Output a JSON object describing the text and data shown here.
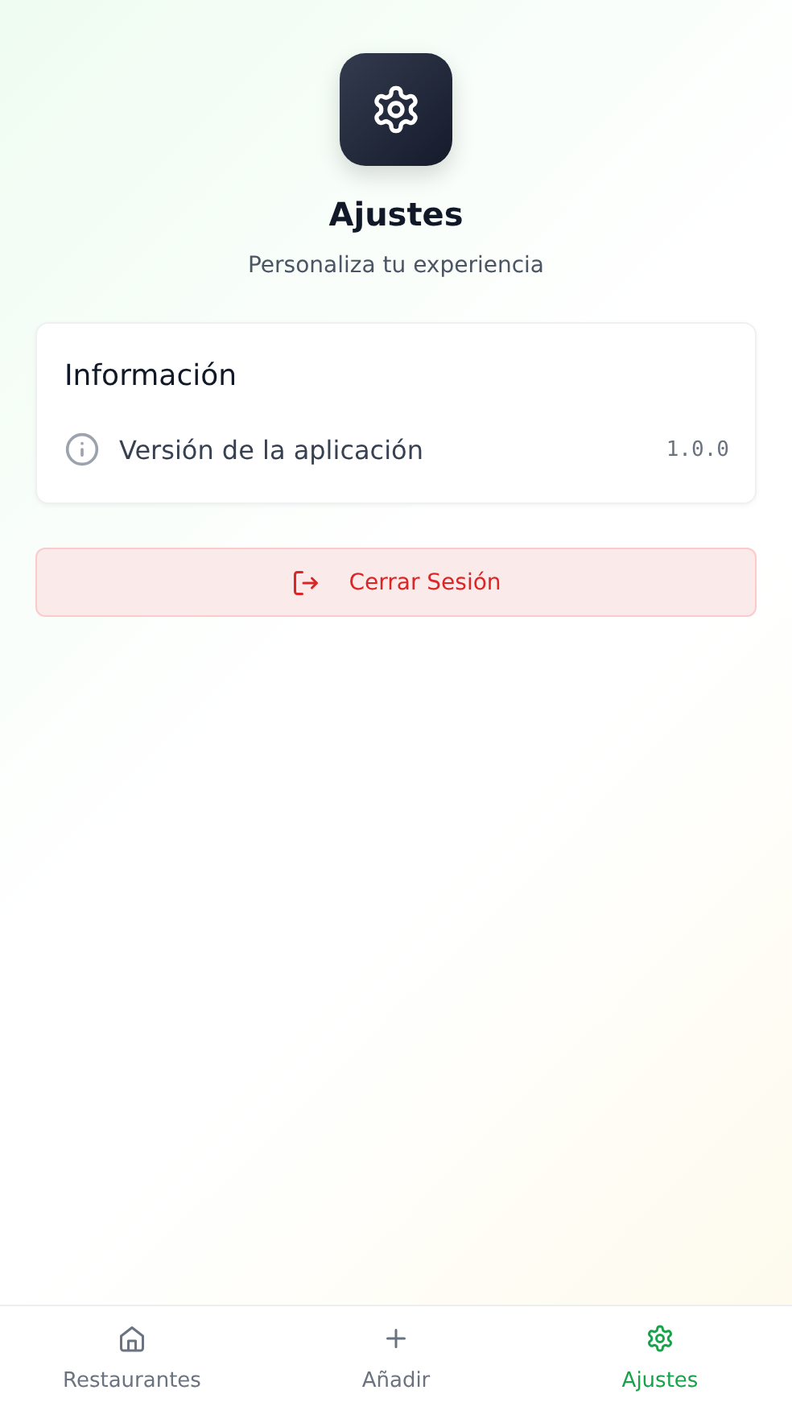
{
  "header": {
    "title": "Ajustes",
    "subtitle": "Personaliza tu experiencia"
  },
  "info_card": {
    "title": "Información",
    "rows": [
      {
        "label": "Versión de la aplicación",
        "value": "1.0.0"
      }
    ]
  },
  "logout_button": {
    "label": "Cerrar Sesión"
  },
  "bottom_nav": [
    {
      "kind": "home",
      "label": "Restaurantes",
      "selected": false
    },
    {
      "kind": "add",
      "label": "Añadir",
      "selected": false
    },
    {
      "kind": "settings",
      "label": "Ajustes",
      "selected": true
    }
  ]
}
